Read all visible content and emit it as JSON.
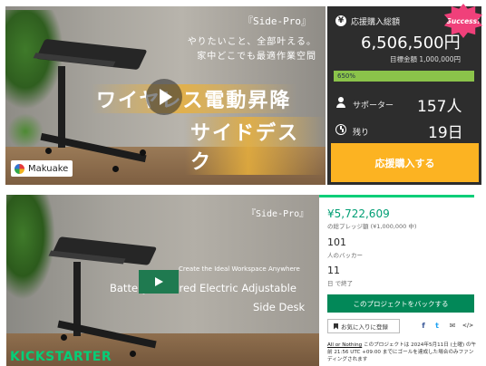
{
  "makuake": {
    "hero": {
      "product_tag": "『Side-Pro』",
      "catch_line1": "やりたいこと、全部叶える。",
      "catch_line2": "家中どこでも最適作業空間",
      "banner_line1": "ワイヤレス電動昇降",
      "banner_line2": "サイドデスク",
      "logo_text": "Makuake"
    },
    "panel": {
      "total_label": "応援購入総額",
      "total_value": "6,506,500円",
      "goal_label": "目標金額 1,000,000円",
      "progress_text": "650%",
      "progress_fraction": 1.0,
      "supporters_label": "サポーター",
      "supporters_value": "157人",
      "remaining_label": "残り",
      "remaining_value": "19日",
      "cta_label": "応援購入する",
      "badge_text": "Success!"
    },
    "colors": {
      "panel_bg": "#2d2d2d",
      "cta": "#fcb322",
      "progress": "#8bc34a",
      "badge": "#f0407a"
    }
  },
  "kickstarter": {
    "hero": {
      "product_tag": "『Side-Pro』",
      "tagline": "Create the Ideal Workspace Anywhere",
      "title_line1": "Battery-Powered Electric Adjustable",
      "title_line2": "Side Desk",
      "logo_text": "KICKSTARTER"
    },
    "panel": {
      "pledged_value": "¥5,722,609",
      "pledged_sub": "の総プレッジ額 (¥1,000,000 中)",
      "backers_value": "101",
      "backers_label": "人のバッカー",
      "days_value": "11",
      "days_label": "日 で終了",
      "back_label": "このプロジェクトをバックする",
      "remind_label": "お気に入りに登録",
      "aon_link": "All or Nothing",
      "aon_text": " このプロジェクトは 2024年5月11日 (土曜) の午前 21:56 UTC +09:00 までにゴールを達成した場合のみファンディングされます",
      "social_icons": [
        "facebook-icon",
        "twitter-icon",
        "email-icon",
        "embed-icon"
      ]
    },
    "colors": {
      "accent": "#05ce78",
      "amount": "#009e74",
      "button": "#028858"
    }
  }
}
